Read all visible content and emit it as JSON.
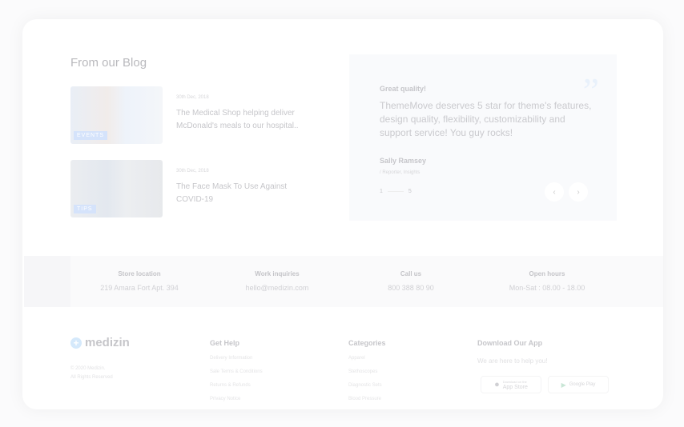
{
  "blog": {
    "title": "From our Blog",
    "posts": [
      {
        "tag": "EVENTS",
        "date": "30th Dec, 2018",
        "title": "The Medical Shop helping deliver McDonald's meals to our hospital.."
      },
      {
        "tag": "TIPS",
        "date": "30th Dec, 2018",
        "title": "The Face Mask To Use Against COVID-19"
      }
    ]
  },
  "testimonial": {
    "label": "Great quality!",
    "text": "ThemeMove deserves 5 star for theme's features, design quality, flexibility, customizability and support service! You guy rocks!",
    "name": "Sally Ramsey",
    "role": "/ Reporter, Insights",
    "page_current": "1",
    "page_total": "5",
    "quote_icon": "quote-icon"
  },
  "info": [
    {
      "heading": "Store location",
      "value": "219 Amara Fort Apt. 394"
    },
    {
      "heading": "Work inquiries",
      "value": "hello@medizin.com"
    },
    {
      "heading": "Call us",
      "value": "800 388 80 90"
    },
    {
      "heading": "Open hours",
      "value": "Mon-Sat : 08.00 - 18.00"
    }
  ],
  "footer": {
    "brand": "medizin",
    "copyright": "© 2020 Medizin.",
    "rights": "All Rights Reserved",
    "help": {
      "title": "Get Help",
      "links": [
        "Delivery Information",
        "Sale Terms & Conditions",
        "Returns & Refunds",
        "Privacy Notice"
      ]
    },
    "categories": {
      "title": "Categories",
      "links": [
        "Apparel",
        "Stethoscopes",
        "Diagnostic Sets",
        "Blood Pressure"
      ]
    },
    "app": {
      "title": "Download Our App",
      "subtitle": "We are here to help you!",
      "appstore_small": "Download on the",
      "appstore": "App Store",
      "googleplay": "Google Play"
    }
  }
}
